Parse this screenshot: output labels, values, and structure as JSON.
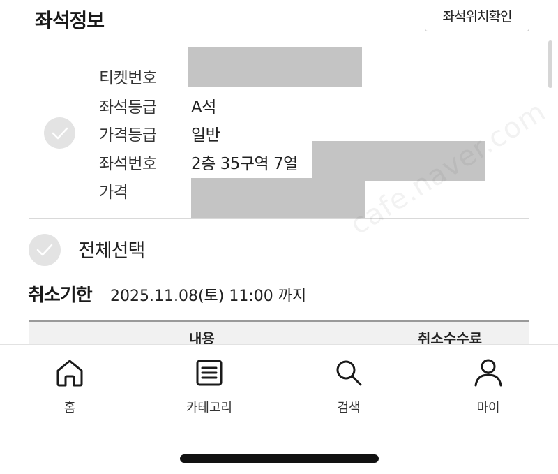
{
  "header": {
    "title": "좌석정보",
    "seat_map_button": "좌석위치확인"
  },
  "ticket": {
    "rows": [
      {
        "label": "티켓번호",
        "value": ""
      },
      {
        "label": "좌석등급",
        "value": "A석"
      },
      {
        "label": "가격등급",
        "value": "일반"
      },
      {
        "label": "좌석번호",
        "value": "2층 35구역 7열"
      },
      {
        "label": "가격",
        "value": ""
      }
    ],
    "watermark": "cafe.naver.com"
  },
  "select_all": {
    "label": "전체선택"
  },
  "cancel_deadline": {
    "title": "취소기한",
    "value": "2025.11.08(토) 11:00 까지"
  },
  "fee_table": {
    "headers": [
      "내용",
      "취소수수료"
    ]
  },
  "bottom_nav": {
    "items": [
      {
        "label": "홈",
        "icon": "home-icon"
      },
      {
        "label": "카테고리",
        "icon": "list-icon"
      },
      {
        "label": "검색",
        "icon": "search-icon"
      },
      {
        "label": "마이",
        "icon": "person-icon"
      }
    ]
  },
  "colors": {
    "check_circle": "#e3e3e3",
    "redaction": "#c4c4c4",
    "text": "#1a1a1a"
  }
}
